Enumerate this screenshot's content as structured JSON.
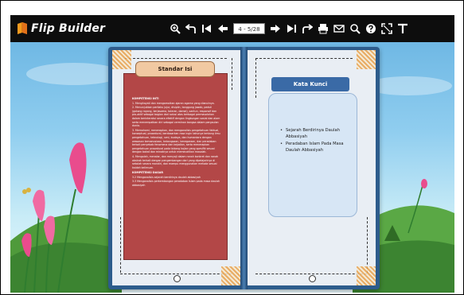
{
  "app": {
    "name": "Flip Builder"
  },
  "toolbar": {
    "page_indicator": "4 - 5/28",
    "icons": [
      "zoom-in-icon",
      "back-icon",
      "first-page-icon",
      "previous-page-icon",
      "page-input",
      "next-page-icon",
      "last-page-icon",
      "forward-icon",
      "print-icon",
      "email-icon",
      "search-icon",
      "help-icon",
      "fullscreen-icon",
      "text-icon"
    ]
  },
  "book": {
    "left_page": {
      "title": "Standar Isi",
      "sections": [
        {
          "heading": "KOMPETENSI INTI",
          "items": [
            "1. Menghayati dan mengamalkan ajaran agama yang dianutnya.",
            "2. Menunjukkan perilaku jujur, disiplin, tanggung jawab, peduli (gotong royong, kerjasama, toleran, damai), santun, responsif dan pro-aktif sebagai bagian dari solusi atas berbagai permasalahan dalam berinteraksi secara efektif dengan lingkungan sosial dan alam serta menempatkan diri sebagai cerminan bangsa dalam pergaulan dunia.",
            "3. Memahami, menerapkan, dan menganalisis pengetahuan faktual, konseptual, prosedural, berdasarkan rasa ingin tahunya tentang ilmu pengetahuan, teknologi, seni, budaya, dan humaniora dengan wawasan kemanusiaan, kebangsaan, kenegaraan, dan peradaban terkait penyebab fenomena dan kejadian, serta menerapkan pengetahuan prosedural pada bidang kajian yang spesifik sesuai dengan bakat dan minatnya untuk memecahkan masalah.",
            "4. Mengolah, menalar, dan menyaji dalam ranah konkret dan ranah abstrak terkait dengan pengembangan dari yang dipelajarinya di sekolah secara mandiri, dan mampu menggunakan metoda sesuai kaidah keilmuan."
          ]
        },
        {
          "heading": "KOMPETENSI DASAR",
          "items": [
            "3.2 Menganalisis sejarah berdirinya daulah abbasiyah",
            "3.3 Menganalisis perkembangan peradaban Islam pada masa daulah abbasiyah"
          ]
        }
      ]
    },
    "right_page": {
      "title": "Kata Kunci",
      "items": [
        "Sejarah Berdirinya Daulah Abbasiyah",
        "Peradaban Islam Pada Masa Daulah Abbasiyah"
      ]
    }
  },
  "colors": {
    "toolbar": "#0d0d0d",
    "book_cover": "#2d5c8c",
    "red_panel": "#b34747",
    "tab_peach": "#f1c9a2",
    "kunci_blue": "#3a6aa6"
  }
}
